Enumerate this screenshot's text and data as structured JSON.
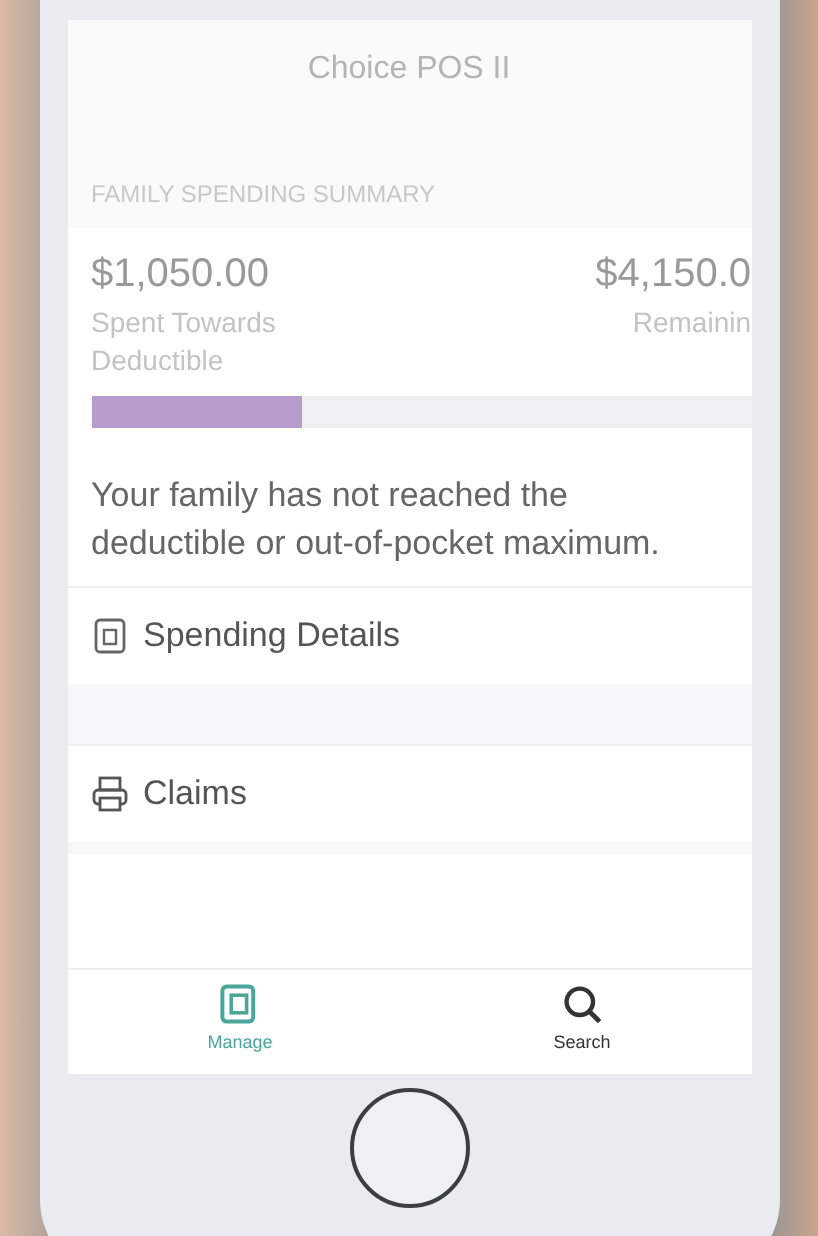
{
  "header": {
    "title": "Choice POS II"
  },
  "summary": {
    "heading": "FAMILY SPENDING SUMMARY",
    "spent_amount": "$1,050.00",
    "spent_label": "Spent Towards Deductible",
    "remaining_amount": "$4,150.0",
    "remaining_label": "Remainin",
    "level": 0.32
  },
  "message": "Your family has not reached the deductible or out-of-pocket maximum.",
  "menu_items": [
    {
      "label": "Spending Details",
      "kind": "document"
    },
    {
      "label": "Claims",
      "kind": "printer"
    }
  ],
  "tabs": [
    {
      "label": "Manage",
      "kind": "manage",
      "selected": true
    },
    {
      "label": "Search",
      "kind": "search",
      "selected": false
    }
  ]
}
